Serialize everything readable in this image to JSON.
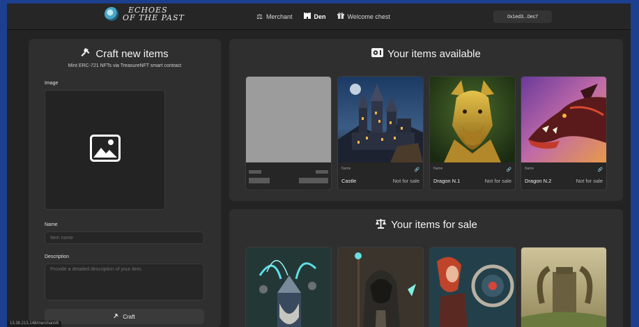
{
  "app": {
    "logo_line1": "ECHOES",
    "logo_line2": "OF THE PAST"
  },
  "nav": {
    "items": [
      {
        "label": "Merchant",
        "icon": "scale-icon"
      },
      {
        "label": "Den",
        "icon": "castle-icon",
        "active": true
      },
      {
        "label": "Welcome chest",
        "icon": "gift-icon"
      }
    ],
    "wallet": "0x1ed3...0ec7"
  },
  "craft": {
    "title": "Craft new items",
    "subtitle": "Mint ERC-721 NFTs via TreasureNFT smart contract",
    "image_label": "Image",
    "name_label": "Name",
    "name_placeholder": "Item name",
    "description_label": "Description",
    "description_placeholder": "Provide a detailed description of your item.",
    "button_label": "Craft"
  },
  "available": {
    "title": "Your items available",
    "items": [
      {
        "name_label": "Name",
        "name": "Castle",
        "status": "Not for sale"
      },
      {
        "name_label": "Name",
        "name": "Dragon N.1",
        "status": "Not for sale"
      },
      {
        "name_label": "Name",
        "name": "Dragon N.2",
        "status": "Not for sale"
      }
    ]
  },
  "for_sale": {
    "title": "Your items for sale"
  },
  "status_bar": {
    "url": "13.38.213.148/merchant/8"
  },
  "colors": {
    "background": "#232323",
    "panel": "#2f2f2f",
    "frame": "#1c3f8f"
  }
}
